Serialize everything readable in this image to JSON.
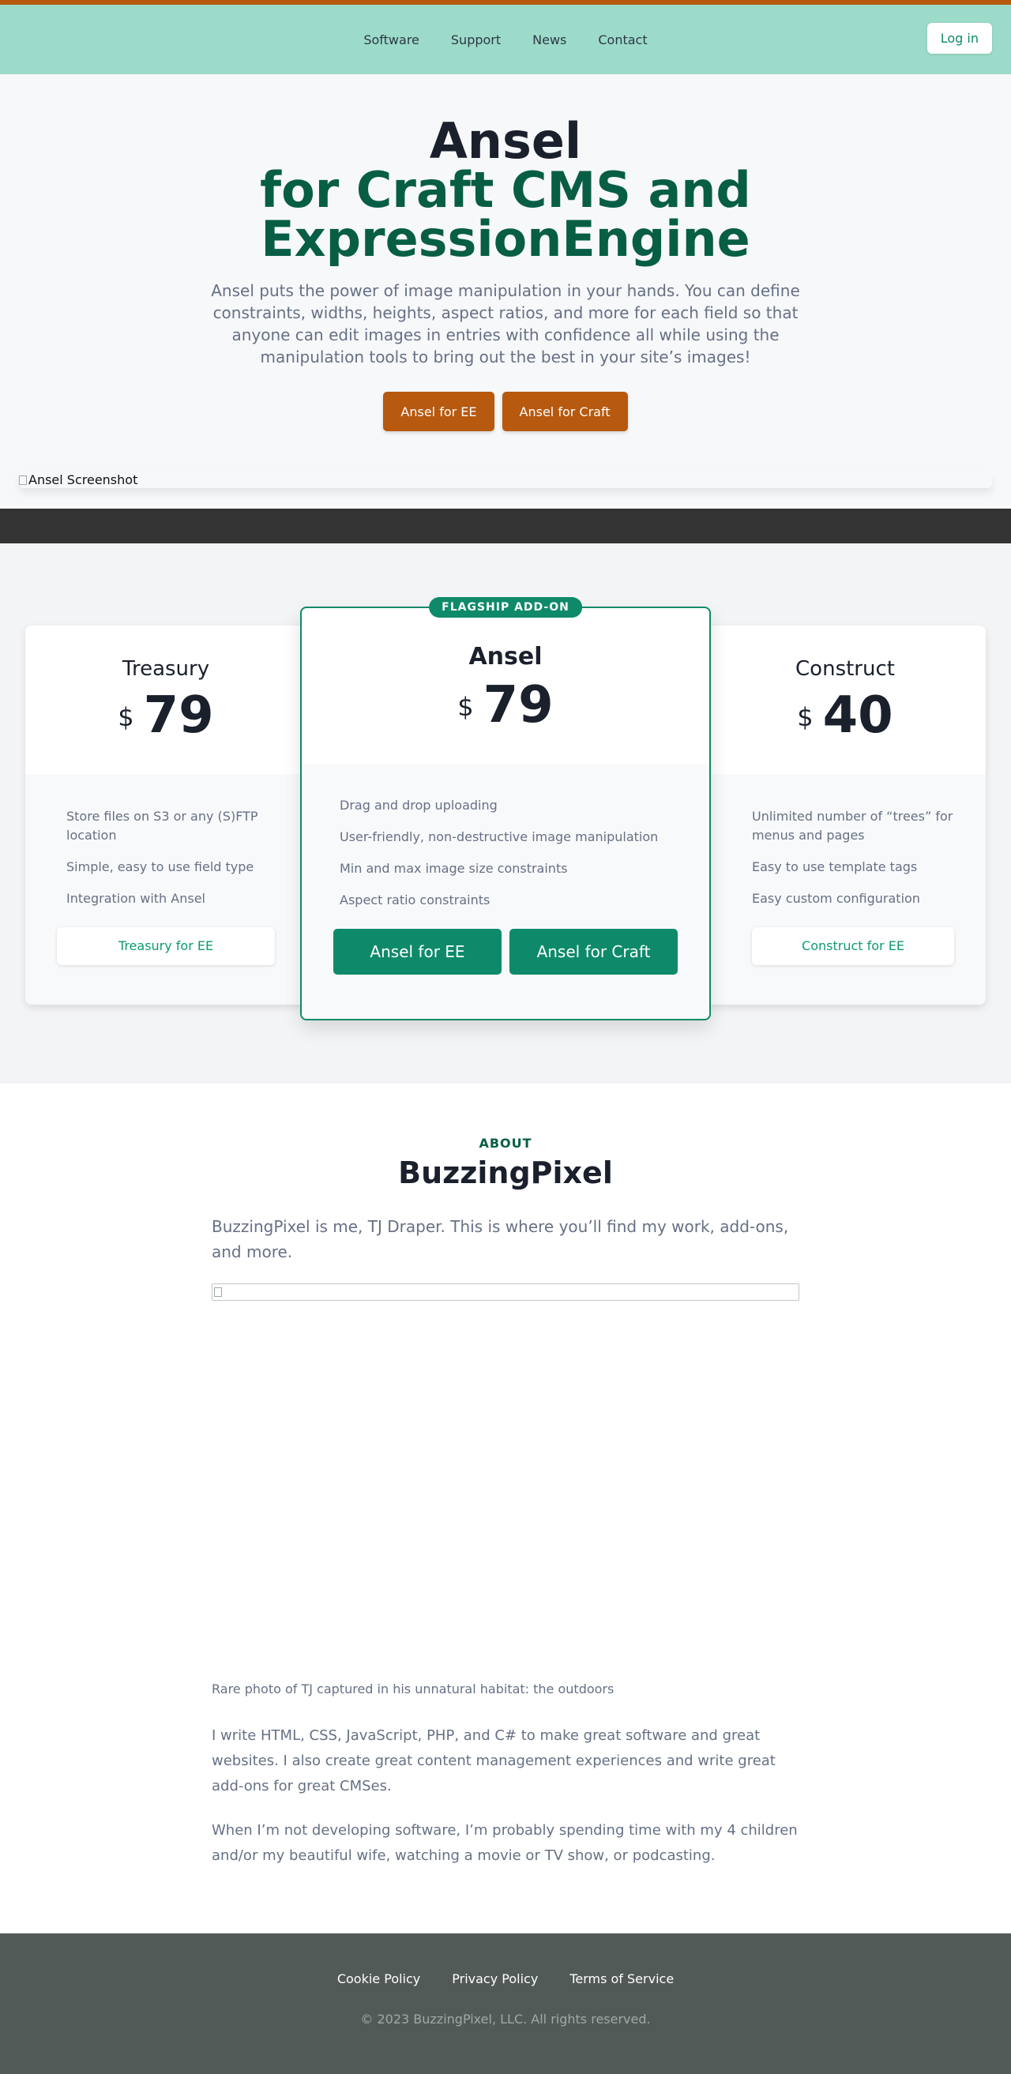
{
  "nav": {
    "links": [
      "Software",
      "Support",
      "News",
      "Contact"
    ],
    "login_label": "Log in"
  },
  "hero": {
    "title_line1": "Ansel",
    "title_line2": "for Craft CMS and",
    "title_line3": "ExpressionEngine",
    "description": "Ansel puts the power of image manipulation in your hands. You can define constraints, widths, heights, aspect ratios, and more for each field so that anyone can edit images in entries with confidence all while using the manipulation tools to bring out the best in your site’s images!",
    "button_ee": "Ansel for EE",
    "button_craft": "Ansel for Craft",
    "screenshot_alt": "Ansel Screenshot"
  },
  "pricing": {
    "left": {
      "name": "Treasury",
      "currency": "$",
      "price": "79",
      "features": [
        "Store files on S3 or any (S)FTP location",
        "Simple, easy to use field type",
        "Integration with Ansel"
      ],
      "button": "Treasury for EE"
    },
    "middle": {
      "badge": "FLAGSHIP ADD-ON",
      "name": "Ansel",
      "currency": "$",
      "price": "79",
      "features": [
        "Drag and drop uploading",
        "User-friendly, non-destructive image manipulation",
        "Min and max image size constraints",
        "Aspect ratio constraints"
      ],
      "button_ee": "Ansel for EE",
      "button_craft": "Ansel for Craft"
    },
    "right": {
      "name": "Construct",
      "currency": "$",
      "price": "40",
      "features": [
        "Unlimited number of “trees” for menus and pages",
        "Easy to use template tags",
        "Easy custom configuration"
      ],
      "button": "Construct for EE"
    }
  },
  "about": {
    "eyebrow": "ABOUT",
    "title": "BuzzingPixel",
    "lead": "BuzzingPixel is me, TJ Draper. This is where you’ll find my work, add-ons, and more.",
    "caption": "Rare photo of TJ captured in his unnatural habitat: the outdoors",
    "paragraph1": "I write HTML, CSS, JavaScript, PHP, and C# to make great software and great websites. I also create great content management experiences and write great add-ons for great CMSes.",
    "paragraph2": "When I’m not developing software, I’m probably spending time with my 4 children and/or my beautiful wife, watching a movie or TV show, or podcasting."
  },
  "footer": {
    "links": [
      "Cookie Policy",
      "Privacy Policy",
      "Terms of Service"
    ],
    "copyright": "© 2023 BuzzingPixel, LLC. All rights reserved."
  },
  "colors": {
    "accent_orange": "#b7590f",
    "nav_mint": "#9cdbc9",
    "brand_green": "#0e8a6a",
    "dark_green": "#075e45",
    "footer_gray": "#525a57"
  }
}
